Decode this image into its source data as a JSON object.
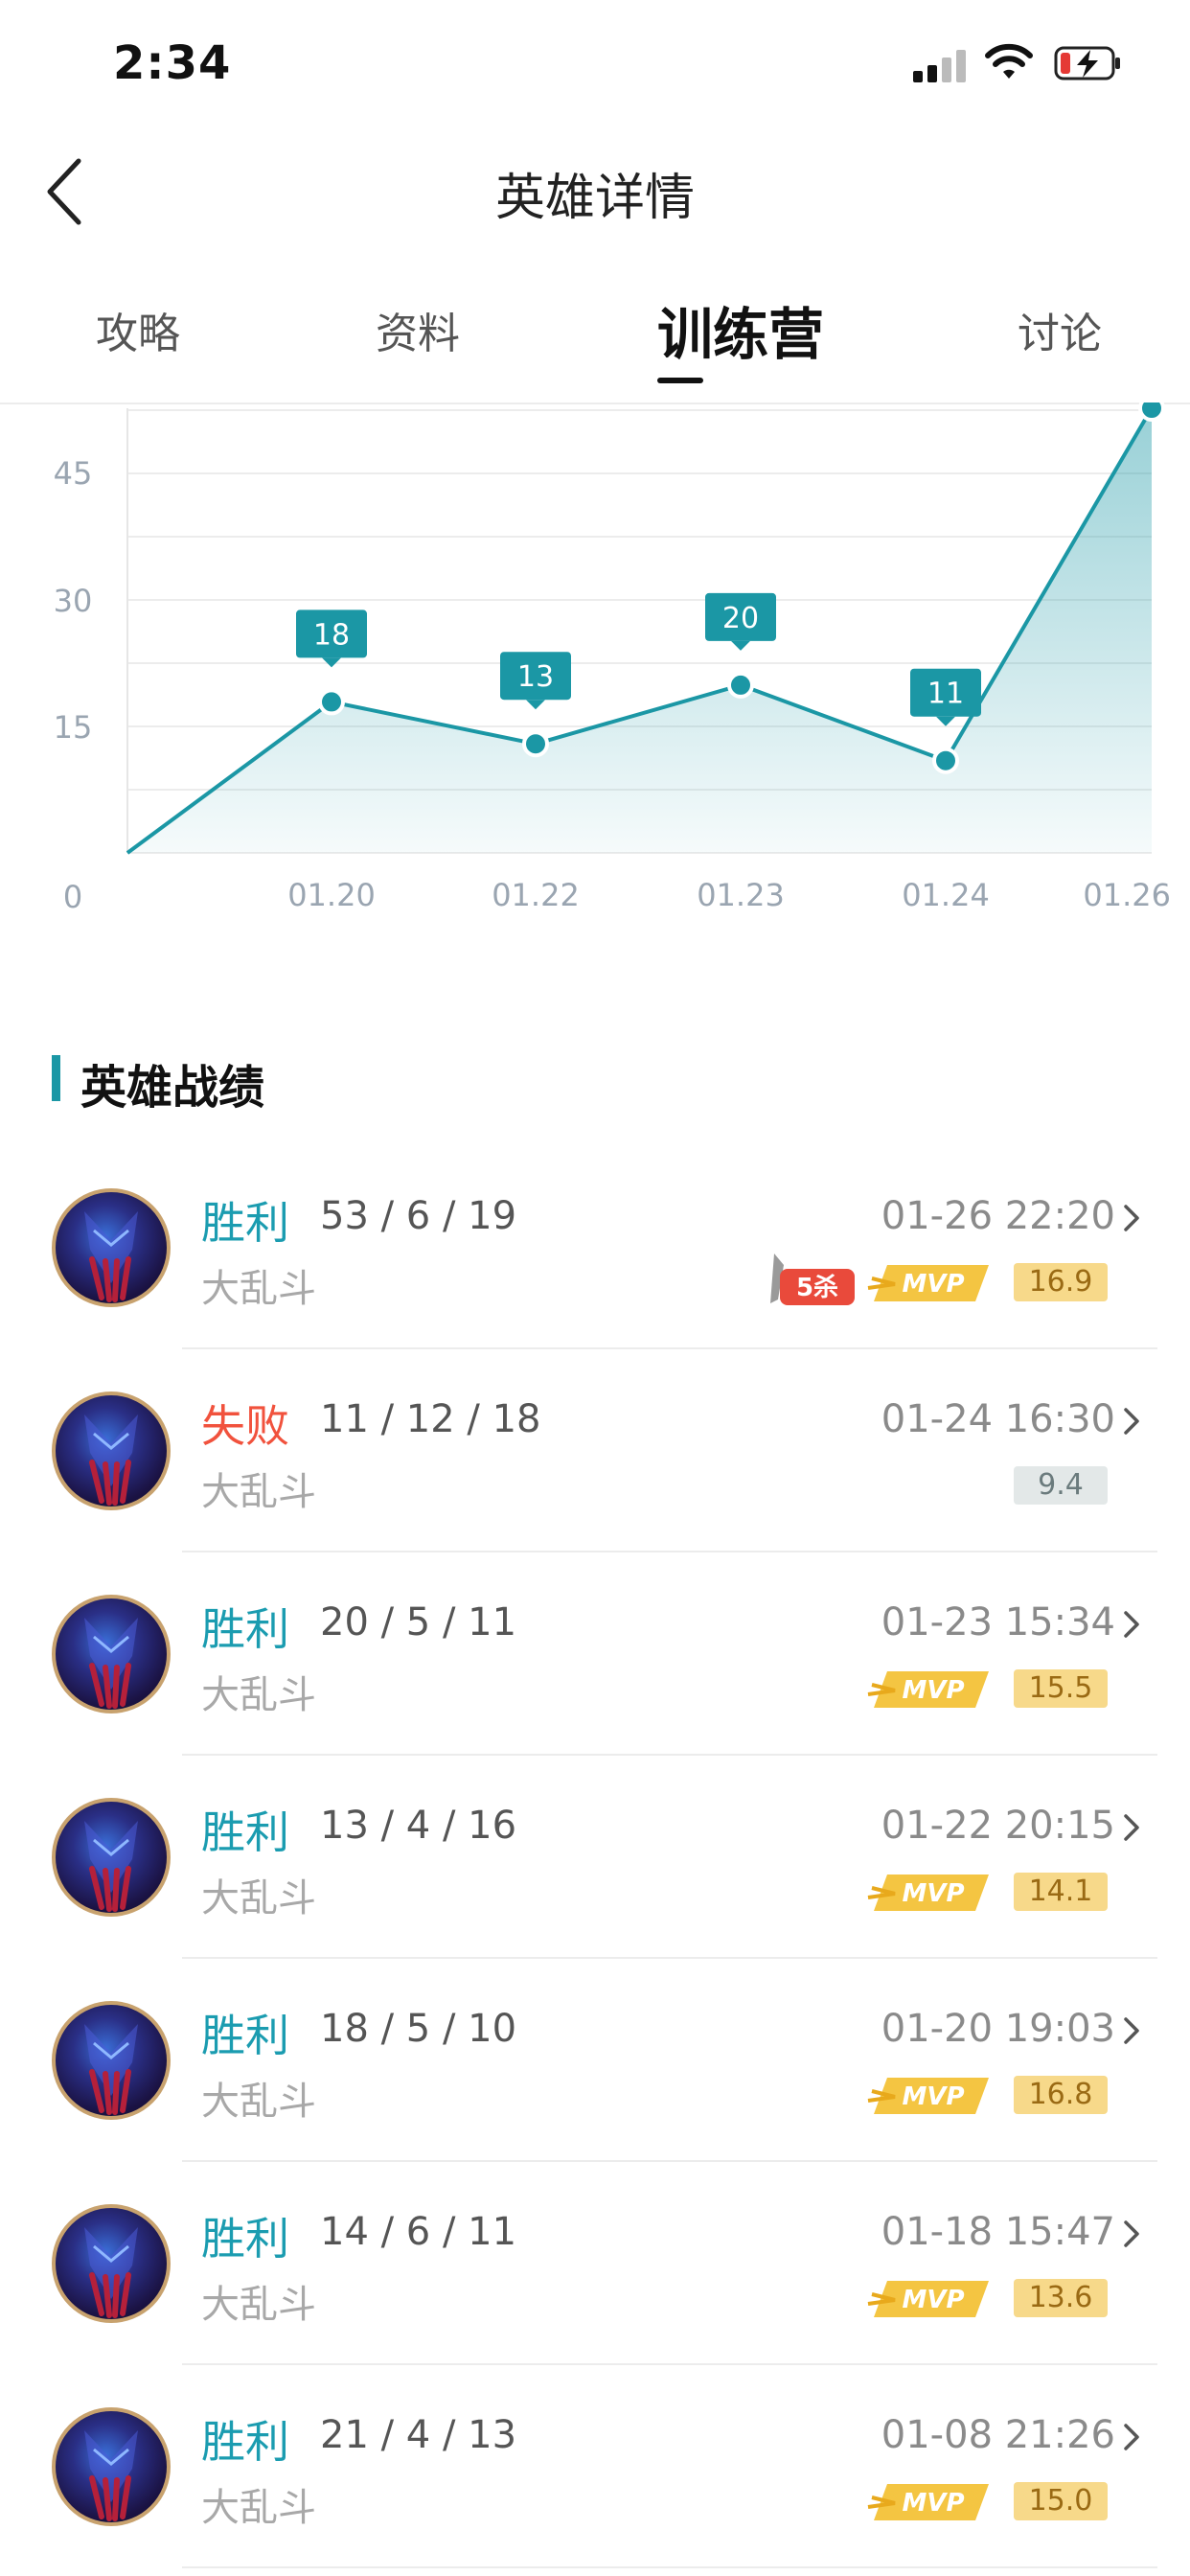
{
  "status_bar": {
    "time": "2:34"
  },
  "header": {
    "title": "英雄详情"
  },
  "tabs": [
    {
      "label": "攻略",
      "active": false
    },
    {
      "label": "资料",
      "active": false
    },
    {
      "label": "训练营",
      "active": true
    },
    {
      "label": "讨论",
      "active": false
    }
  ],
  "chart_data": {
    "type": "area",
    "x": [
      "",
      "01.20",
      "01.22",
      "01.23",
      "01.24",
      "01.26"
    ],
    "values": [
      0,
      18,
      13,
      20,
      11,
      53
    ],
    "point_labels": [
      "",
      "18",
      "13",
      "20",
      "11",
      ""
    ],
    "y_ticks": [
      "0",
      "15",
      "30",
      "45"
    ],
    "ylim": [
      0,
      53
    ],
    "color": "#1b97a5"
  },
  "section": {
    "title": "英雄战绩"
  },
  "colors": {
    "accent": "#1b97a5",
    "win": "#1b9cb0",
    "loss": "#f1523d",
    "gold_badge": "#f7d98a"
  },
  "matches": [
    {
      "result": "胜利",
      "outcome": "win",
      "kda": "53 / 6 / 19",
      "mode": "大乱斗",
      "time": "01-26 22:20",
      "score": "16.9",
      "mvp": true,
      "mvp_text": "MVP",
      "pentakill": true,
      "pentakill_text": "5杀",
      "score_style": "gold"
    },
    {
      "result": "失败",
      "outcome": "loss",
      "kda": "11 / 12 / 18",
      "mode": "大乱斗",
      "time": "01-24 16:30",
      "score": "9.4",
      "mvp": false,
      "pentakill": false,
      "score_style": "grey"
    },
    {
      "result": "胜利",
      "outcome": "win",
      "kda": "20 / 5 / 11",
      "mode": "大乱斗",
      "time": "01-23 15:34",
      "score": "15.5",
      "mvp": true,
      "mvp_text": "MVP",
      "pentakill": false,
      "score_style": "gold"
    },
    {
      "result": "胜利",
      "outcome": "win",
      "kda": "13 / 4 / 16",
      "mode": "大乱斗",
      "time": "01-22 20:15",
      "score": "14.1",
      "mvp": true,
      "mvp_text": "MVP",
      "pentakill": false,
      "score_style": "gold"
    },
    {
      "result": "胜利",
      "outcome": "win",
      "kda": "18 / 5 / 10",
      "mode": "大乱斗",
      "time": "01-20 19:03",
      "score": "16.8",
      "mvp": true,
      "mvp_text": "MVP",
      "pentakill": false,
      "score_style": "gold"
    },
    {
      "result": "胜利",
      "outcome": "win",
      "kda": "14 / 6 / 11",
      "mode": "大乱斗",
      "time": "01-18 15:47",
      "score": "13.6",
      "mvp": true,
      "mvp_text": "MVP",
      "pentakill": false,
      "score_style": "gold"
    },
    {
      "result": "胜利",
      "outcome": "win",
      "kda": "21 / 4 / 13",
      "mode": "大乱斗",
      "time": "01-08 21:26",
      "score": "15.0",
      "mvp": true,
      "mvp_text": "MVP",
      "pentakill": false,
      "score_style": "gold"
    }
  ]
}
